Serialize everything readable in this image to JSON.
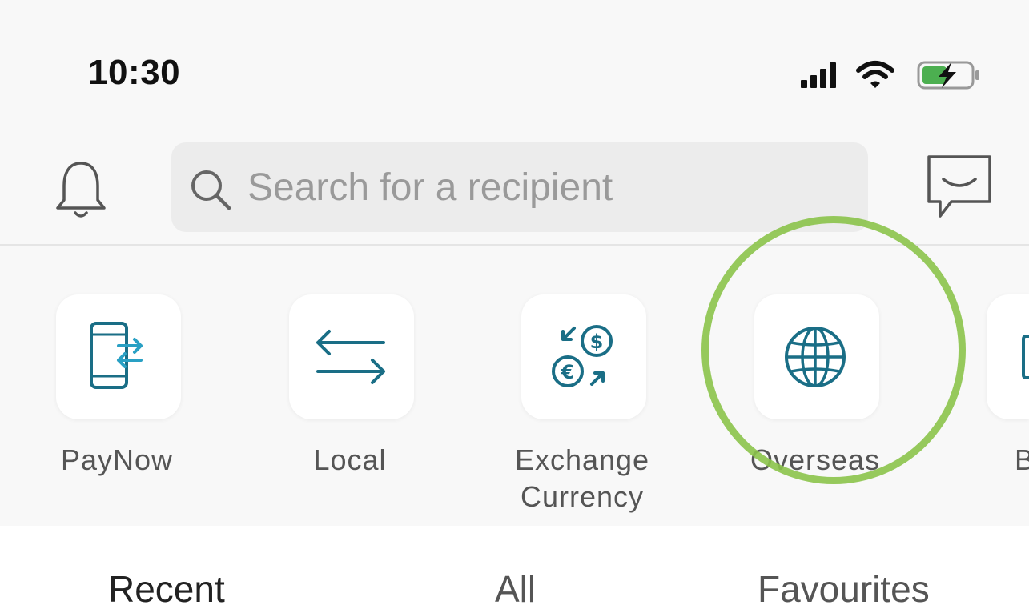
{
  "status_bar": {
    "time": "10:30",
    "icons": [
      "signal-icon",
      "wifi-icon",
      "battery-charging-icon"
    ],
    "battery_color": "#4caf50"
  },
  "header": {
    "search": {
      "placeholder": "Search for a recipient"
    },
    "left_icon": "bell-icon",
    "right_icon": "chat-icon"
  },
  "actions": {
    "accent": "#1a6e86",
    "highlight_color": "#8bc34a",
    "items": [
      {
        "label": "PayNow",
        "icon": "phone-transfer-icon"
      },
      {
        "label": "Local",
        "icon": "transfer-arrows-icon"
      },
      {
        "label": "Exchange Currency",
        "line1": "Exchange",
        "line2": "Currency",
        "icon": "currency-exchange-icon"
      },
      {
        "label": "Overseas",
        "icon": "globe-icon"
      },
      {
        "label": "B",
        "icon": "partial-tile-icon"
      }
    ]
  },
  "tabs": {
    "items": [
      {
        "label": "Recent"
      },
      {
        "label": "All"
      },
      {
        "label": "Favourites"
      }
    ]
  }
}
